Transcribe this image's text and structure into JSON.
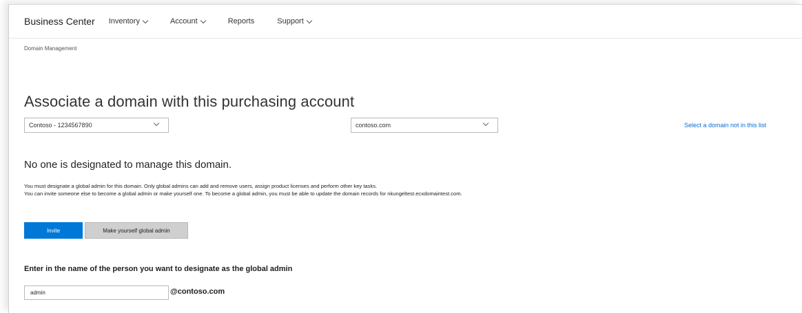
{
  "header": {
    "brand": "Business Center",
    "nav": [
      {
        "label": "Inventory",
        "has_menu": true
      },
      {
        "label": "Account",
        "has_menu": true
      },
      {
        "label": "Reports",
        "has_menu": false
      },
      {
        "label": "Support",
        "has_menu": true
      }
    ]
  },
  "breadcrumb": "Domain Management",
  "page": {
    "title": "Associate a domain with this purchasing account",
    "account_select": {
      "value": "Contoso - 1234567890",
      "icon": "chevron-down-icon"
    },
    "domain_select": {
      "value": "contoso.com",
      "icon": "chevron-down-icon"
    },
    "select_other_link": "Select a domain not in this list",
    "status_heading": "No one is designated to manage this domain.",
    "paragraph_line1": "You must designate a global admin for this domain. Only global admins can add and remove users, assign product licenses and perform other key tasks.",
    "paragraph_line2": "You can invite someone else to become a global admin or make yourself one. To become a global admin, you must be able to update the domain records for nkungeltest.ecxdomaintest.com.",
    "invite_button": "Invite",
    "make_self_button": "Make yourself global admin",
    "designate_label": "Enter in the name of the person you want to designate as the global admin",
    "admin_input_value": "admin",
    "domain_suffix": "@contoso.com"
  },
  "colors": {
    "accent": "#0078d7",
    "link": "#0a6ed1",
    "secondary_button": "#cfcfcf"
  }
}
